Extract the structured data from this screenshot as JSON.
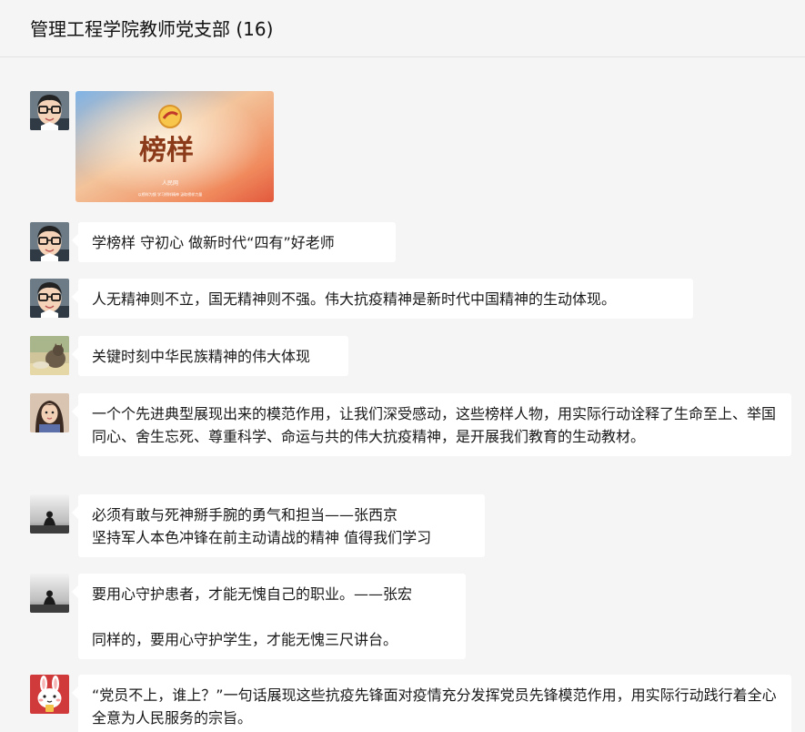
{
  "header": {
    "title": "管理工程学院教师党支部 (16)"
  },
  "image_message": {
    "poster_title": "榜样",
    "poster_logo": "人民网",
    "poster_caption": "以榜样为镜 学习榜样精神 汲取榜样力量"
  },
  "messages": [
    {
      "avatar": "cartoon-glasses-man-avatar",
      "text": "学榜样 守初心 做新时代“四有”好老师"
    },
    {
      "avatar": "cartoon-glasses-man-avatar",
      "text": "人无精神则不立，国无精神则不强。伟大抗疫精神是新时代中国精神的生动体现。"
    },
    {
      "avatar": "cat-photo-avatar",
      "text": "关键时刻中华民族精神的伟大体现"
    },
    {
      "avatar": "girl-photo-avatar",
      "text": "一个个先进典型展现出来的模范作用，让我们深受感动，这些榜样人物，用实际行动诠释了生命至上、举国同心、舍生忘死、尊重科学、命运与共的伟大抗疫精神，是开展我们教育的生动教材。"
    },
    {
      "avatar": "silhouette-photo-avatar",
      "text": "必须有敢与死神掰手腕的勇气和担当——张西京\n坚持军人本色冲锋在前主动请战的精神 值得我们学习"
    },
    {
      "avatar": "silhouette-photo-avatar",
      "text": "要用心守护患者，才能无愧自己的职业。——张宏\n\n同样的，要用心守护学生，才能无愧三尺讲台。"
    },
    {
      "avatar": "rabbit-cartoon-avatar",
      "text": "“党员不上，谁上？”一句话展现这些抗疫先锋面对疫情充分发挥党员先锋模范作用，用实际行动践行着全心全意为人民服务的宗旨。"
    }
  ],
  "colors": {
    "background": "#f5f5f5",
    "bubble": "#ffffff",
    "text": "#191919"
  }
}
